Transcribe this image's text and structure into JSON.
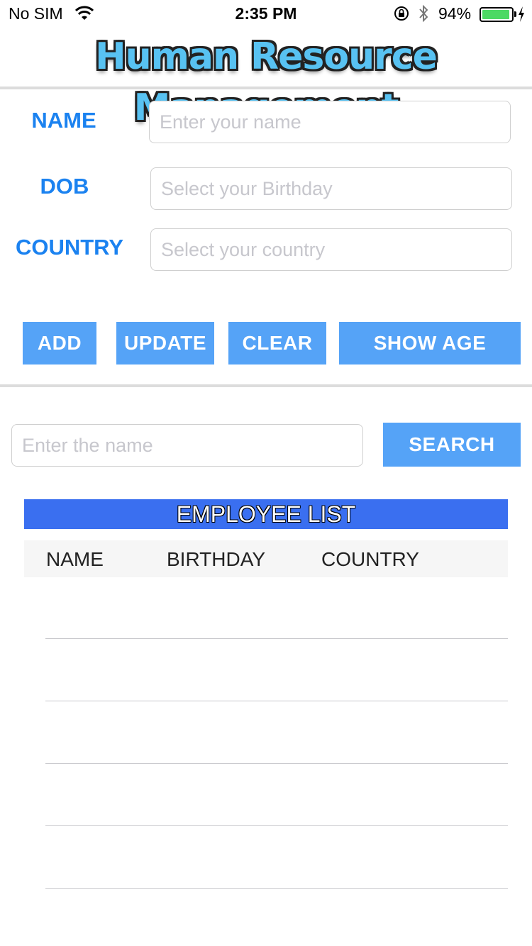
{
  "status_bar": {
    "carrier": "No SIM",
    "time": "2:35 PM",
    "battery": "94%",
    "icons": [
      "wifi-icon",
      "orientation-lock-icon",
      "bluetooth-icon",
      "battery-icon",
      "charging-bolt-icon"
    ]
  },
  "banner": {
    "title": "Human Resource Management"
  },
  "form": {
    "name_label": "NAME",
    "name_placeholder": "Enter your name",
    "dob_label": "DOB",
    "dob_placeholder": "Select your Birthday",
    "country_label": "COUNTRY",
    "country_placeholder": "Select your country"
  },
  "actions": {
    "add": "ADD",
    "update": "UPDATE",
    "clear": "CLEAR",
    "show_age": "SHOW AGE"
  },
  "search": {
    "placeholder": "Enter the name",
    "button": "SEARCH"
  },
  "employee_list": {
    "title": "EMPLOYEE LIST",
    "columns": [
      "NAME",
      "BIRTHDAY",
      "COUNTRY"
    ],
    "rows": []
  },
  "colors": {
    "label_blue": "#1b82f0",
    "button_blue": "#55a3f7",
    "list_title_blue": "#3a6ff0",
    "banner_cyan": "#58c2f2"
  }
}
